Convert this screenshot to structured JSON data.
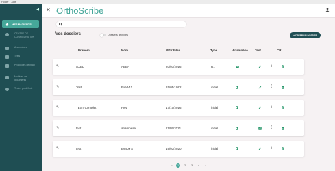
{
  "menubar": [
    "Fichier",
    "Aide"
  ],
  "sidebar": {
    "active_item": "MES PATIENTS",
    "items": [
      {
        "label": "CENTRE DE CONFIGURATION"
      },
      {
        "label": "Anamnèses"
      },
      {
        "label": "Tests"
      },
      {
        "label": "Protocoles de bilan"
      },
      {
        "label": "Modèles de documents"
      },
      {
        "label": "Textes prédéfinis"
      }
    ]
  },
  "header": {
    "logo_a": "Ortho",
    "logo_b": "Scribe"
  },
  "search": {
    "placeholder": ""
  },
  "main": {
    "title": "Vos dossiers",
    "toggle_label": "Dossiers archivés",
    "create_label": "+ CRÉER UN DOSSIER"
  },
  "table": {
    "columns": [
      "Prénom",
      "Nom",
      "RDV bilan",
      "Type",
      "Anamnèse",
      "Test",
      "CR"
    ],
    "rows": [
      {
        "prenom": "AXEL",
        "nom": "ABBA",
        "rdv": "20/01/2016",
        "type": "R1"
      },
      {
        "prenom": "Test",
        "nom": "Exalt-11",
        "rdv": "15/05/1992",
        "type": "initial"
      },
      {
        "prenom": "TEST Complet",
        "nom": "Fred",
        "rdv": "17/10/2016",
        "type": "initial"
      },
      {
        "prenom": "test",
        "nom": "anamnèse",
        "rdv": "11/05/2021",
        "type": "initial"
      },
      {
        "prenom": "test",
        "nom": "EvaDYS",
        "rdv": "19/03/2020",
        "type": "initial"
      }
    ]
  },
  "pagination": {
    "pages": [
      "1",
      "2",
      "3",
      "4"
    ],
    "prev": "‹",
    "next": "›",
    "current": "1"
  },
  "colors": {
    "sidebar": "#1f4e53",
    "accent": "#46a79a"
  }
}
